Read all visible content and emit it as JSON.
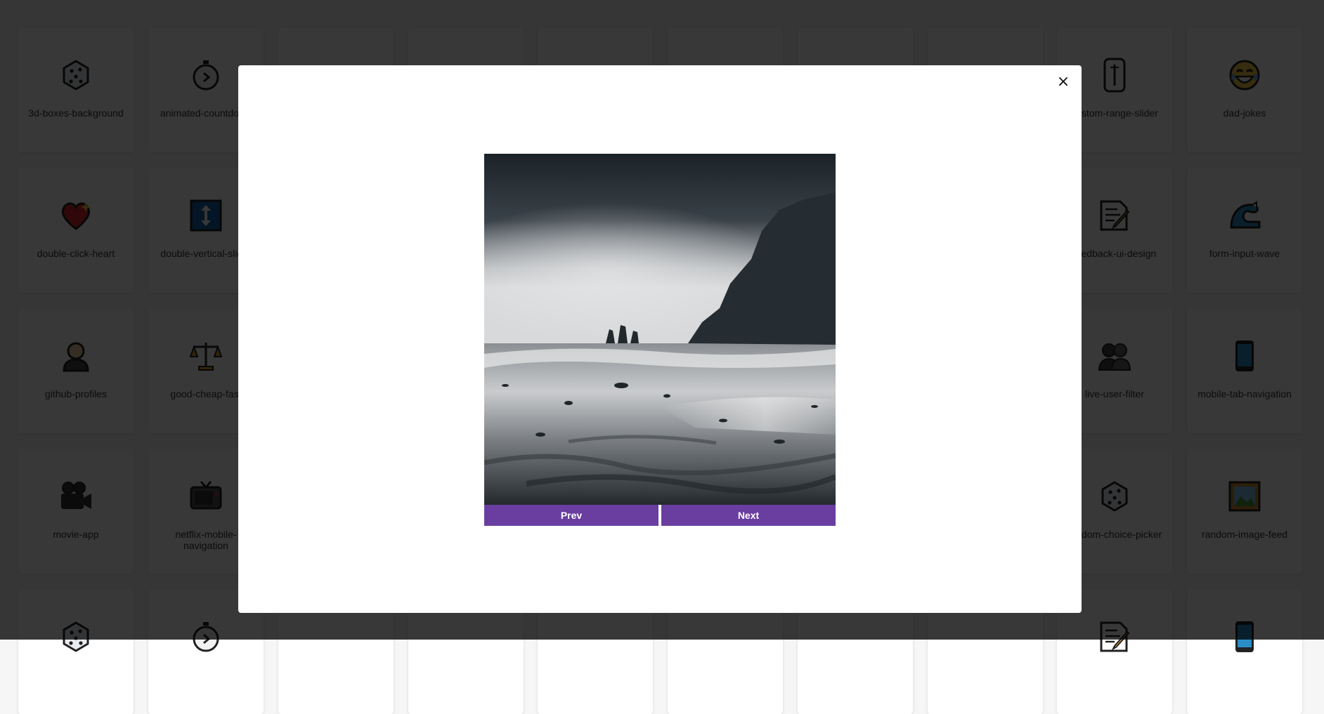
{
  "projects": [
    {
      "label": "3d-boxes-background",
      "icon": "die-icon"
    },
    {
      "label": "animated-countdown",
      "icon": "stopwatch-icon"
    },
    {
      "label": "",
      "icon": "blank-icon"
    },
    {
      "label": "",
      "icon": "blank-icon"
    },
    {
      "label": "",
      "icon": "blank-icon"
    },
    {
      "label": "",
      "icon": "blank-icon"
    },
    {
      "label": "",
      "icon": "blank-icon"
    },
    {
      "label": "",
      "icon": "blank-icon"
    },
    {
      "label": "custom-range-slider",
      "icon": "thermometer-icon"
    },
    {
      "label": "dad-jokes",
      "icon": "laughing-face-icon"
    },
    {
      "label": "double-click-heart",
      "icon": "sparkling-heart-icon"
    },
    {
      "label": "double-vertical-slider",
      "icon": "up-down-arrow-icon"
    },
    {
      "label": "",
      "icon": "blank-icon"
    },
    {
      "label": "",
      "icon": "blank-icon"
    },
    {
      "label": "",
      "icon": "blank-icon"
    },
    {
      "label": "",
      "icon": "blank-icon"
    },
    {
      "label": "",
      "icon": "blank-icon"
    },
    {
      "label": "",
      "icon": "blank-icon"
    },
    {
      "label": "feedback-ui-design",
      "icon": "memo-icon"
    },
    {
      "label": "form-input-wave",
      "icon": "wave-icon"
    },
    {
      "label": "github-profiles",
      "icon": "person-icon"
    },
    {
      "label": "good-cheap-fast",
      "icon": "balance-scale-icon"
    },
    {
      "label": "",
      "icon": "blank-icon"
    },
    {
      "label": "",
      "icon": "blank-icon"
    },
    {
      "label": "",
      "icon": "blank-icon"
    },
    {
      "label": "",
      "icon": "blank-icon"
    },
    {
      "label": "",
      "icon": "blank-icon"
    },
    {
      "label": "",
      "icon": "blank-icon"
    },
    {
      "label": "live-user-filter",
      "icon": "people-icon"
    },
    {
      "label": "mobile-tab-navigation",
      "icon": "mobile-phone-icon"
    },
    {
      "label": "movie-app",
      "icon": "movie-camera-icon"
    },
    {
      "label": "netflix-mobile-navigation",
      "icon": "television-icon"
    },
    {
      "label": "",
      "icon": "blank-icon"
    },
    {
      "label": "",
      "icon": "blank-icon"
    },
    {
      "label": "",
      "icon": "blank-icon"
    },
    {
      "label": "",
      "icon": "blank-icon"
    },
    {
      "label": "",
      "icon": "blank-icon"
    },
    {
      "label": "",
      "icon": "blank-icon"
    },
    {
      "label": "random-choice-picker",
      "icon": "die-icon"
    },
    {
      "label": "random-image-feed",
      "icon": "framed-picture-icon"
    }
  ],
  "modal": {
    "close_label": "×",
    "prev_label": "Prev",
    "next_label": "Next",
    "image_description": "black and white beach with sea stacks and cliffs"
  },
  "colors": {
    "accent": "#6a3ea1",
    "overlay": "rgba(0,0,0,0.78)"
  }
}
